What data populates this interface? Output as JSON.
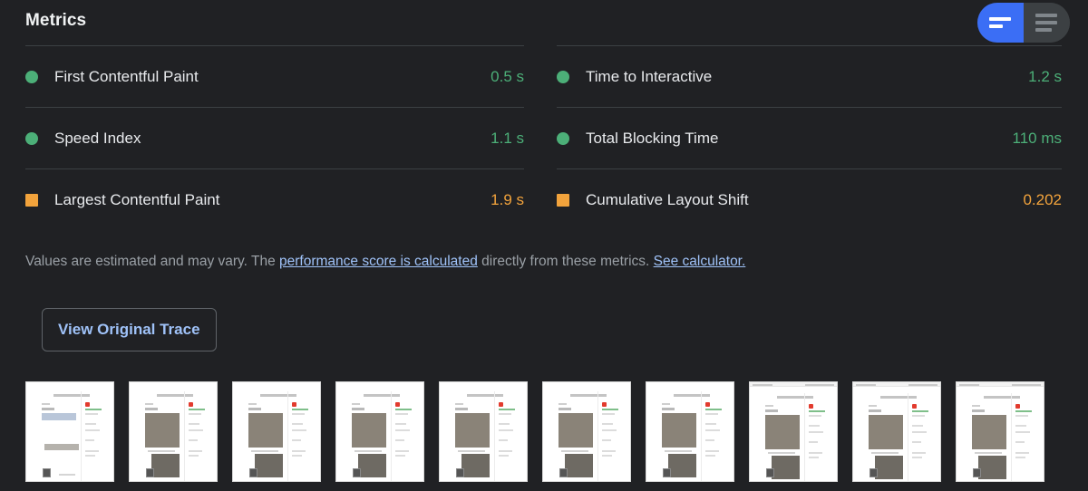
{
  "header": {
    "title": "Metrics",
    "toggle": {
      "name": "metrics-view-toggle",
      "active_segment": "simple-view",
      "segments": [
        {
          "id": "simple-view",
          "label": "Simple view",
          "active": true,
          "line_count": 2
        },
        {
          "id": "expanded-view",
          "label": "Expanded view",
          "active": false,
          "line_count": 3
        }
      ]
    }
  },
  "colors": {
    "background": "#202124",
    "separator": "#3c4043",
    "good": "#4caf78",
    "average": "#f2a33c",
    "link": "#9fc2f8",
    "accent": "#3b6ef5",
    "text_primary": "#e8eaed",
    "text_secondary": "#9aa0a6"
  },
  "metrics": {
    "left_column": [
      {
        "name": "First Contentful Paint",
        "value": "0.5 s",
        "rating": "good",
        "indicator": "circle-icon"
      },
      {
        "name": "Speed Index",
        "value": "1.1 s",
        "rating": "good",
        "indicator": "circle-icon"
      },
      {
        "name": "Largest Contentful Paint",
        "value": "1.9 s",
        "rating": "average",
        "indicator": "square-icon"
      }
    ],
    "right_column": [
      {
        "name": "Time to Interactive",
        "value": "1.2 s",
        "rating": "good",
        "indicator": "circle-icon"
      },
      {
        "name": "Total Blocking Time",
        "value": "110 ms",
        "rating": "good",
        "indicator": "circle-icon"
      },
      {
        "name": "Cumulative Layout Shift",
        "value": "0.202",
        "rating": "average",
        "indicator": "square-icon"
      }
    ]
  },
  "disclaimer": {
    "part1": "Values are estimated and may vary. The ",
    "link1": "performance score is calculated",
    "part2": " directly from these metrics. ",
    "link2": "See calculator."
  },
  "trace_button": {
    "label": "View Original Trace"
  },
  "filmstrip": {
    "frames": [
      {
        "index": 1,
        "state": "loading-placeholder",
        "has_top_bar": false,
        "has_hero": false,
        "has_second_image": false
      },
      {
        "index": 2,
        "state": "rendered",
        "has_top_bar": false,
        "has_hero": true,
        "has_second_image": true
      },
      {
        "index": 3,
        "state": "rendered",
        "has_top_bar": false,
        "has_hero": true,
        "has_second_image": true
      },
      {
        "index": 4,
        "state": "rendered",
        "has_top_bar": false,
        "has_hero": true,
        "has_second_image": true
      },
      {
        "index": 5,
        "state": "rendered",
        "has_top_bar": false,
        "has_hero": true,
        "has_second_image": true
      },
      {
        "index": 6,
        "state": "rendered",
        "has_top_bar": false,
        "has_hero": true,
        "has_second_image": true
      },
      {
        "index": 7,
        "state": "rendered",
        "has_top_bar": false,
        "has_hero": true,
        "has_second_image": true
      },
      {
        "index": 8,
        "state": "rendered-with-header",
        "has_top_bar": true,
        "has_hero": true,
        "has_second_image": true
      },
      {
        "index": 9,
        "state": "rendered-with-header",
        "has_top_bar": true,
        "has_hero": true,
        "has_second_image": true
      },
      {
        "index": 10,
        "state": "rendered-with-header",
        "has_top_bar": true,
        "has_hero": true,
        "has_second_image": true
      }
    ]
  }
}
